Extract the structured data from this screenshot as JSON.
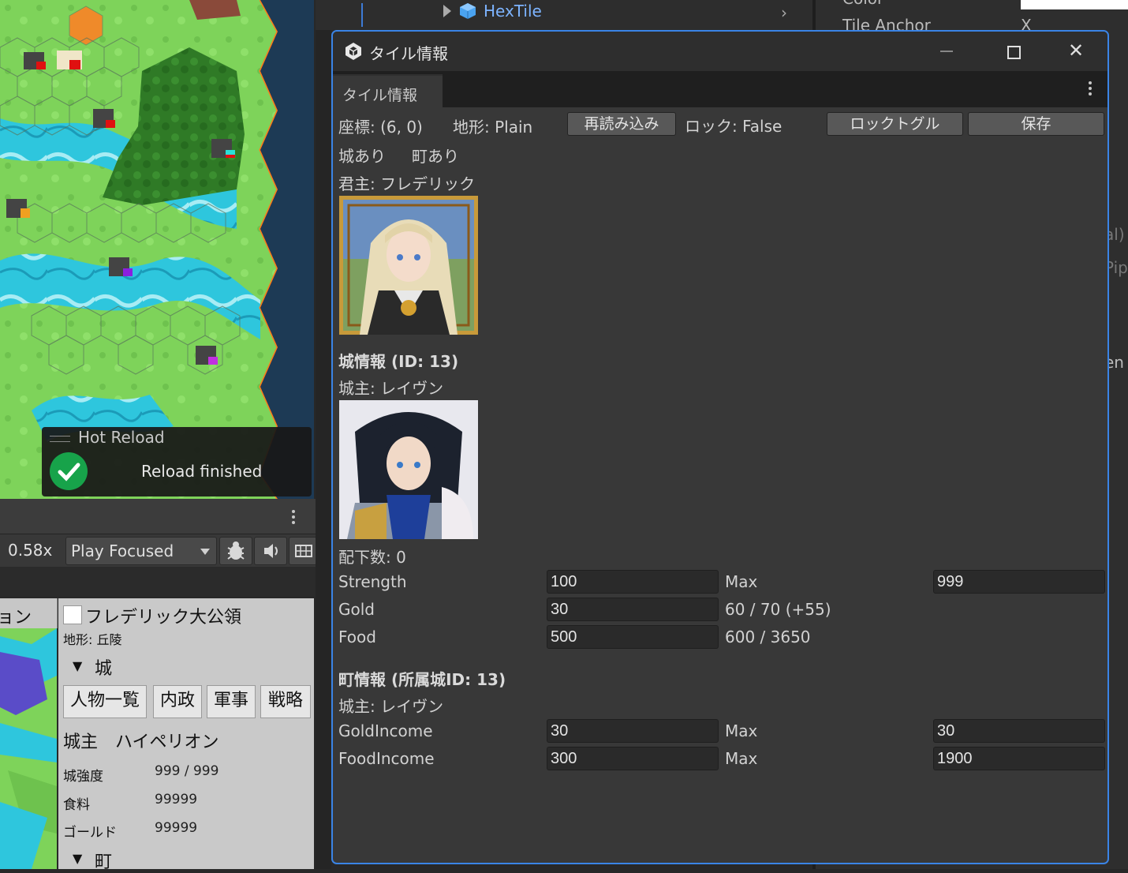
{
  "hierarchy": {
    "item_label": "HexTile"
  },
  "inspector": {
    "color_label": "Color",
    "tile_anchor_label": "Tile Anchor",
    "anchor_axis": "X",
    "frag_al": "al)",
    "frag_pip": "Pip",
    "frag_en": "en"
  },
  "toast": {
    "title": "Hot Reload",
    "message": "Reload finished"
  },
  "game_view": {
    "zoom": "0.58x",
    "play_mode": "Play Focused"
  },
  "game_panel": {
    "minimap_tab": "ョン",
    "faction_name": "フレデリック大公領",
    "terrain": "地形: 丘陵",
    "castle_header": "城",
    "buttons": [
      "人物一覧",
      "内政",
      "軍事",
      "戦略"
    ],
    "lord_line": "城主　ハイペリオン",
    "stats": [
      {
        "label": "城強度",
        "value": "999 / 999"
      },
      {
        "label": "食料",
        "value": "99999"
      },
      {
        "label": "ゴールド",
        "value": "99999"
      }
    ],
    "town_header": "町"
  },
  "window": {
    "title": "タイル情報",
    "tab_label": "タイル情報",
    "coords": "座標: (6, 0)",
    "terrain": "地形: Plain",
    "reload_button": "再読み込み",
    "lock_status": "ロック: False",
    "lock_toggle_button": "ロックトグル",
    "save_button": "保存",
    "has_castle": "城あり",
    "has_town": "町あり",
    "ruler": "君主: フレデリック",
    "castle_section": {
      "header": "城情報 (ID: 13)",
      "lord": "城主: レイヴン",
      "subordinates": "配下数: 0",
      "rows": [
        {
          "label": "Strength",
          "value": "100",
          "extra_label": "Max",
          "extra_value": "999"
        },
        {
          "label": "Gold",
          "value": "30",
          "extra_label": "60 / 70 (+55)"
        },
        {
          "label": "Food",
          "value": "500",
          "extra_label": "600 / 3650"
        }
      ]
    },
    "town_section": {
      "header": "町情報 (所属城ID: 13)",
      "lord": "城主: レイヴン",
      "rows": [
        {
          "label": "GoldIncome",
          "value": "30",
          "extra_label": "Max",
          "extra_value": "30"
        },
        {
          "label": "FoodIncome",
          "value": "300",
          "extra_label": "Max",
          "extra_value": "1900"
        }
      ]
    }
  },
  "colors": {
    "accent": "#3a84e6",
    "window_bg": "#383838",
    "field_bg": "#2a2a2a",
    "hierarchy_link": "#7db4ff",
    "success": "#17a34a"
  }
}
